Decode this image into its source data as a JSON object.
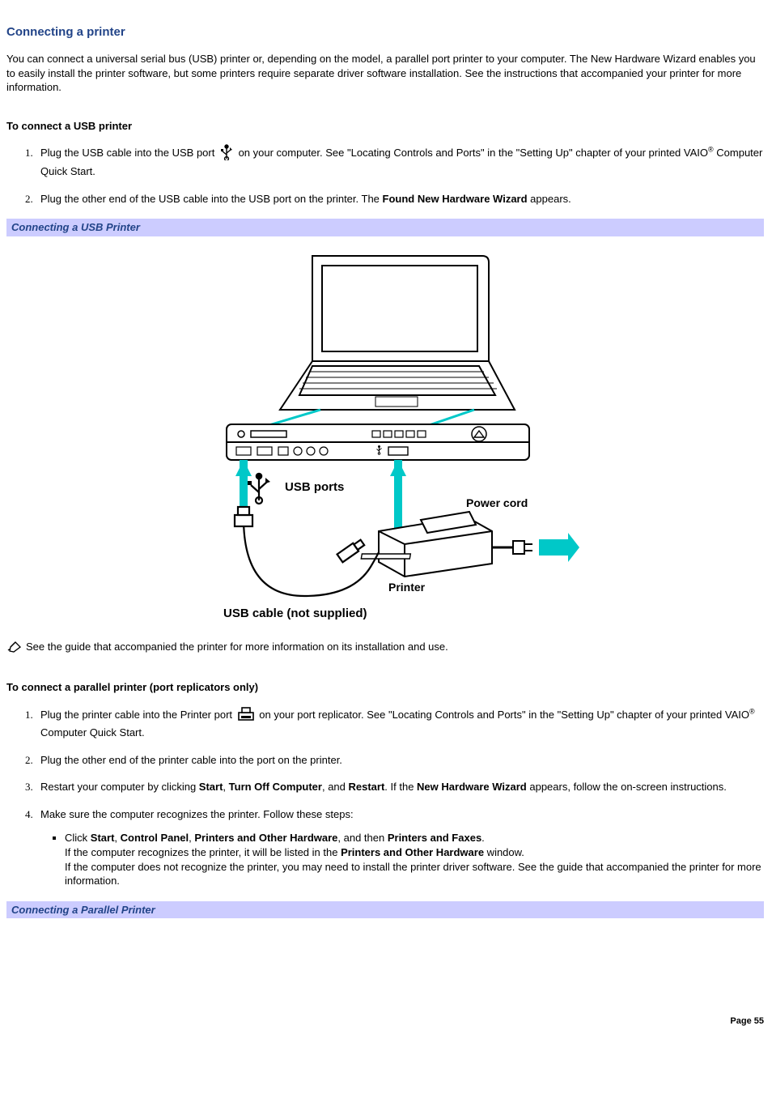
{
  "title": "Connecting a printer",
  "intro": "You can connect a universal serial bus (USB) printer or, depending on the model, a parallel port printer to your computer. The New Hardware Wizard enables you to easily install the printer software, but some printers require separate driver software installation. See the instructions that accompanied your printer for more information.",
  "usb": {
    "heading": "To connect a USB printer",
    "step1_a": "Plug the USB cable into the USB port ",
    "step1_b": " on your computer. See \"Locating Controls and Ports\" in the \"Setting Up\" chapter of your printed VAIO",
    "step1_c": " Computer Quick Start.",
    "step2_a": "Plug the other end of the USB cable into the USB port on the printer. The ",
    "step2_bold": "Found New Hardware Wizard",
    "step2_b": " appears."
  },
  "callout1": "Connecting a USB Printer",
  "figure": {
    "usb_ports": "USB ports",
    "power_cord": "Power cord",
    "printer": "Printer",
    "usb_cable": "USB cable (not supplied)"
  },
  "note": "See the guide that accompanied the printer for more information on its installation and use.",
  "parallel": {
    "heading": "To connect a parallel printer (port replicators only)",
    "step1_a": "Plug the printer cable into the Printer port ",
    "step1_b": " on your port replicator. See \"Locating Controls and Ports\" in the \"Setting Up\" chapter of your printed VAIO",
    "step1_c": " Computer Quick Start.",
    "step2": "Plug the other end of the printer cable into the port on the printer.",
    "step3_a": "Restart your computer by clicking ",
    "step3_b1": "Start",
    "step3_s1": ", ",
    "step3_b2": "Turn Off Computer",
    "step3_s2": ", and ",
    "step3_b3": "Restart",
    "step3_s3": ". If the ",
    "step3_b4": "New Hardware Wizard",
    "step3_s4": " appears, follow the on-screen instructions.",
    "step4": "Make sure the computer recognizes the printer. Follow these steps:",
    "sub_a1": "Click ",
    "sub_b1": "Start",
    "sub_s1": ", ",
    "sub_b2": "Control Panel",
    "sub_s2": ", ",
    "sub_b3": "Printers and Other Hardware",
    "sub_s3": ", and then ",
    "sub_b4": "Printers and Faxes",
    "sub_s4": ".",
    "sub_line2a": "If the computer recognizes the printer, it will be listed in the ",
    "sub_line2b": "Printers and Other Hardware",
    "sub_line2c": " window.",
    "sub_line3": "If the computer does not recognize the printer, you may need to install the printer driver software. See the guide that accompanied the printer for more information."
  },
  "callout2": "Connecting a Parallel Printer",
  "reg": "®",
  "page": "Page 55"
}
